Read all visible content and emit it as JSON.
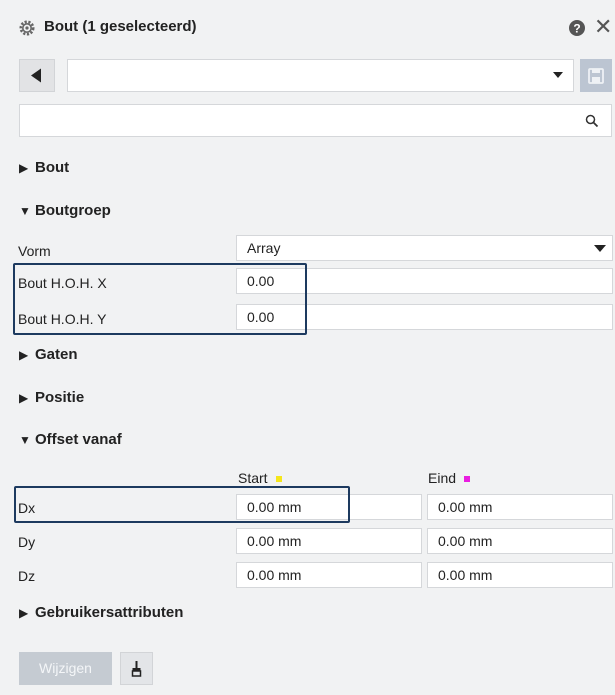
{
  "title": "Bout (1 geselecteerd)",
  "profile": {
    "value": ""
  },
  "search": {
    "placeholder": "",
    "value": ""
  },
  "sections": {
    "bout": "Bout",
    "boutgroep": "Boutgroep",
    "gaten": "Gaten",
    "positie": "Positie",
    "offset": "Offset vanaf",
    "attributes": "Gebruikersattributen"
  },
  "boutgroep": {
    "vorm_label": "Vorm",
    "vorm_value": "Array",
    "hoh_x_label": "Bout H.O.H. X",
    "hoh_x_value": "0.00",
    "hoh_y_label": "Bout H.O.H. Y",
    "hoh_y_value": "0.00"
  },
  "offset": {
    "start_label": "Start",
    "end_label": "Eind",
    "start_color": "#f5e61a",
    "end_color": "#e91ee0",
    "rows": [
      {
        "label": "Dx",
        "start": "0.00 mm",
        "end": "0.00 mm"
      },
      {
        "label": "Dy",
        "start": "0.00 mm",
        "end": "0.00 mm"
      },
      {
        "label": "Dz",
        "start": "0.00 mm",
        "end": "0.00 mm"
      }
    ]
  },
  "footer": {
    "modify_label": "Wijzigen"
  },
  "colors": {
    "panel_bg": "#f1f2f3",
    "highlight_border": "#1d3a5f",
    "disabled_button": "#c5cbd2"
  }
}
